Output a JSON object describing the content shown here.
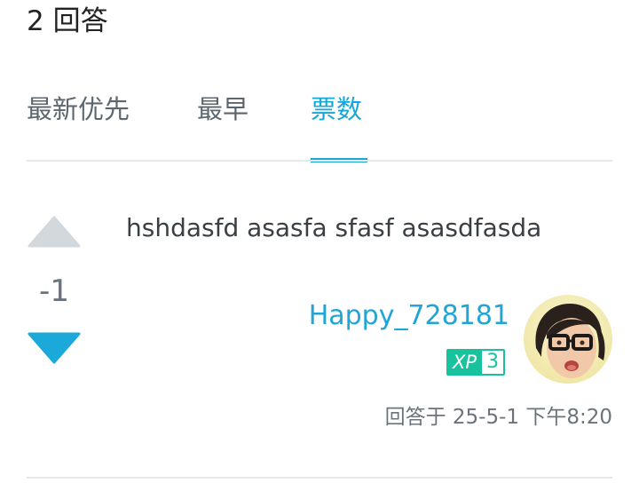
{
  "header": {
    "answers_count": "2 回答"
  },
  "tabs": [
    {
      "label": "最新优先"
    },
    {
      "label": "最早"
    },
    {
      "label": "票数"
    }
  ],
  "active_tab": "票数",
  "answer": {
    "text": "hshdasfd asasfa sfasf asasdfasda",
    "vote_count": "-1",
    "author": {
      "name": "Happy_728181",
      "xp_label": "XP",
      "level": "3"
    },
    "timestamp": "回答于 25-5-1 下午8:20"
  },
  "colors": {
    "accent": "#1aa9d9",
    "xp_badge": "#18c29c",
    "upvote_inactive": "#d3d8dc",
    "downvote_active": "#1aa9d9"
  }
}
